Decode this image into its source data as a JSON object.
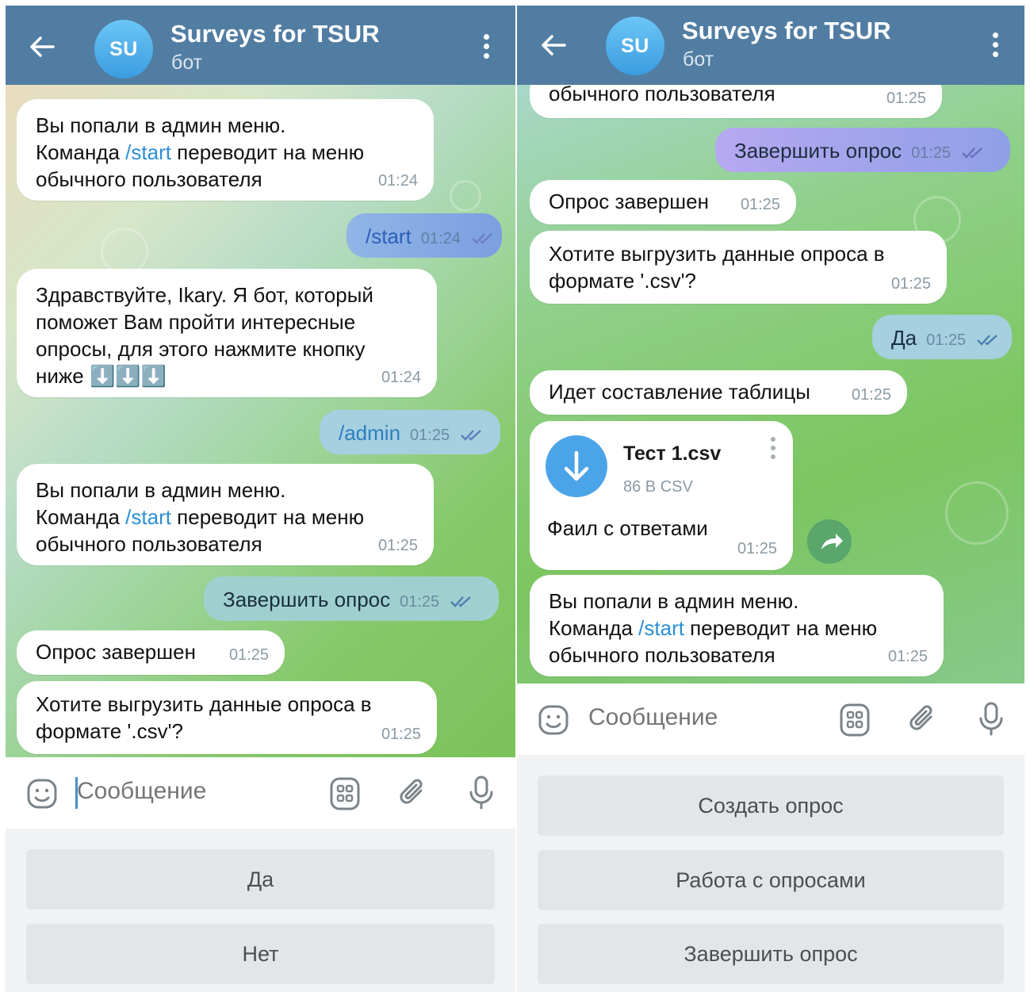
{
  "chat": {
    "name": "Surveys for TSUR",
    "subtitle": "бот",
    "avatar_initials": "SU"
  },
  "composer": {
    "placeholder": "Сообщение"
  },
  "left_screen": {
    "messages": [
      {
        "line1": "Вы попали в админ меню.",
        "line2_pre": "Команда ",
        "cmd": "/start",
        "line2_post": " переводит на меню",
        "line3": "обычного пользователя",
        "time": "01:24"
      },
      {
        "text": "/start",
        "time": "01:24"
      },
      {
        "lines": [
          "Здравствуйте, Ikary. Я бот, который",
          "поможет Вам пройти интересные",
          "опросы, для этого нажмите кнопку",
          "ниже ⬇️⬇️⬇️"
        ],
        "time": "01:24"
      },
      {
        "text": "/admin",
        "time": "01:25"
      },
      {
        "line1": "Вы попали в админ меню.",
        "line2_pre": "Команда ",
        "cmd": "/start",
        "line2_post": " переводит на меню",
        "line3": "обычного пользователя",
        "time": "01:25"
      },
      {
        "text": "Завершить опрос",
        "time": "01:25"
      },
      {
        "text": "Опрос завершен",
        "time": "01:25"
      },
      {
        "lines": [
          "Хотите выгрузить данные опроса в",
          "формате '.csv'?"
        ],
        "time": "01:25"
      }
    ],
    "keyboard": [
      "Да",
      "Нет"
    ]
  },
  "right_screen": {
    "messages": [
      {
        "text": "обычного пользователя",
        "time": "01:25"
      },
      {
        "text": "Завершить опрос",
        "time": "01:25"
      },
      {
        "text": "Опрос завершен",
        "time": "01:25"
      },
      {
        "lines": [
          "Хотите выгрузить данные опроса в",
          "формате '.csv'?"
        ],
        "time": "01:25"
      },
      {
        "text": "Да",
        "time": "01:25"
      },
      {
        "text": "Идет составление таблицы",
        "time": "01:25"
      },
      {
        "file_name": "Тест 1.csv",
        "file_meta": "86 B CSV",
        "caption": "Фаил с ответами",
        "time": "01:25"
      },
      {
        "line1": "Вы попали в админ меню.",
        "line2_pre": "Команда ",
        "cmd": "/start",
        "line2_post": " переводит на меню",
        "line3": "обычного пользователя",
        "time": "01:25"
      }
    ],
    "keyboard": [
      "Создать опрос",
      "Работа с опросами",
      "Завершить опрос"
    ]
  },
  "colors": {
    "header": "#517da2",
    "link": "#2b8fd6",
    "outgoing_bubble": "#a6cfe0",
    "accent": "#4ca4e8"
  },
  "icons": [
    "back-arrow-icon",
    "kebab-menu-icon",
    "emoji-icon",
    "bot-commands-icon",
    "attach-icon",
    "microphone-icon",
    "double-check-icon",
    "download-icon",
    "share-icon"
  ]
}
